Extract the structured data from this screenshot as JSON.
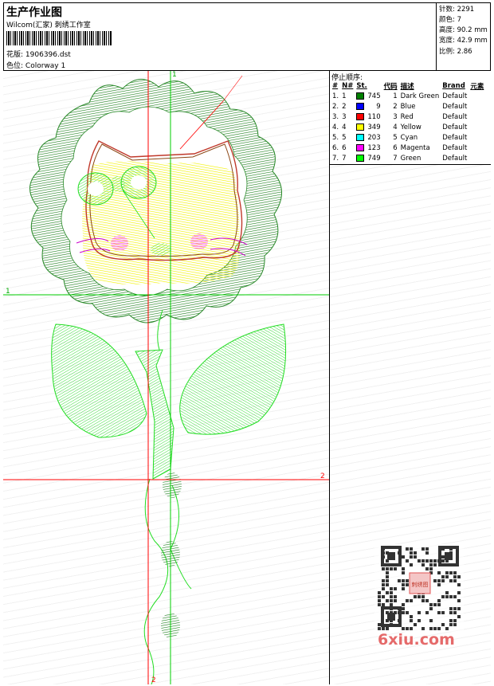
{
  "header": {
    "title": "生产作业图",
    "company": "Wilcom(汇家) 刺绣工作室",
    "design_label": "花版:",
    "design_value": "1906396.dst",
    "colorway_label": "色位:",
    "colorway_value": "Colorway 1"
  },
  "stats": [
    {
      "label": "针数:",
      "value": "2291"
    },
    {
      "label": "颜色:",
      "value": "7"
    },
    {
      "label": "高度:",
      "value": "90.2 mm"
    },
    {
      "label": "宽度:",
      "value": "42.9 mm"
    },
    {
      "label": "比例:",
      "value": "2.86"
    }
  ],
  "stop_sequence": {
    "title": "停止顺序:",
    "columns": [
      "#",
      "N#",
      "St.",
      "代码",
      "描述",
      "Brand",
      "元素"
    ],
    "rows": [
      {
        "idx": "1.",
        "n": "1",
        "color": "#008000",
        "st": "745",
        "code": "1",
        "desc": "Dark Green",
        "brand": "Default"
      },
      {
        "idx": "2.",
        "n": "2",
        "color": "#0000ff",
        "st": "9",
        "code": "2",
        "desc": "Blue",
        "brand": "Default"
      },
      {
        "idx": "3.",
        "n": "3",
        "color": "#ff0000",
        "st": "110",
        "code": "3",
        "desc": "Red",
        "brand": "Default"
      },
      {
        "idx": "4.",
        "n": "4",
        "color": "#ffff00",
        "st": "349",
        "code": "4",
        "desc": "Yellow",
        "brand": "Default"
      },
      {
        "idx": "5.",
        "n": "5",
        "color": "#00ffff",
        "st": "203",
        "code": "5",
        "desc": "Cyan",
        "brand": "Default"
      },
      {
        "idx": "6.",
        "n": "6",
        "color": "#ff00ff",
        "st": "123",
        "code": "6",
        "desc": "Magenta",
        "brand": "Default"
      },
      {
        "idx": "7.",
        "n": "7",
        "color": "#00ff00",
        "st": "749",
        "code": "7",
        "desc": "Green",
        "brand": "Default"
      }
    ]
  },
  "guides": {
    "v_green_top": "1",
    "h_green_left": "1",
    "h_red_right": "2",
    "v_red_bottom": "2"
  },
  "watermark": {
    "text": "6xiu.com",
    "seal": "刺绣图"
  }
}
